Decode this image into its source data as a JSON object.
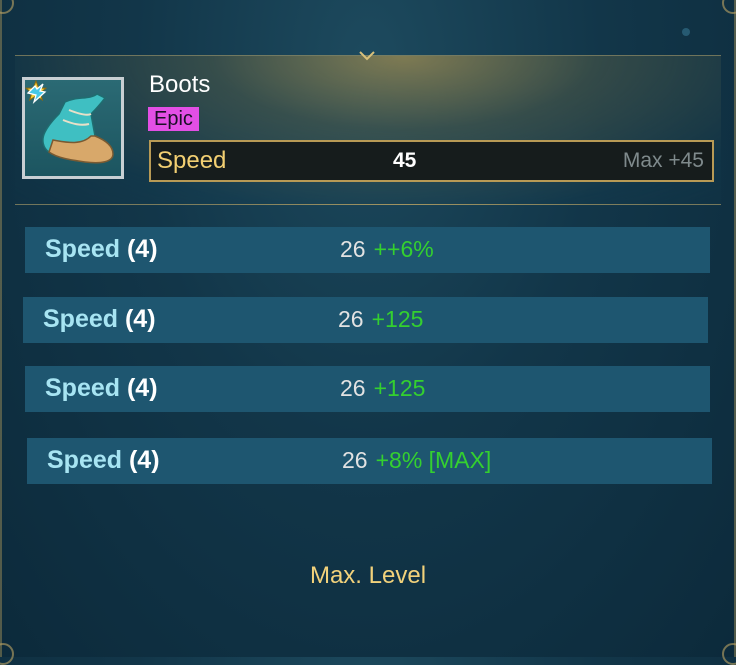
{
  "item": {
    "name": "Boots",
    "rarity": "Epic",
    "icon": "boots-icon",
    "rank_icon": "star-icon",
    "set_icon": "speed-set-icon"
  },
  "main_stat": {
    "name": "Speed",
    "value": "45",
    "max_label": "Max +45"
  },
  "substats": [
    {
      "name": "Speed",
      "rolls": "(4)",
      "value": "26",
      "bonus": "++6%"
    },
    {
      "name": "Speed",
      "rolls": "(4)",
      "value": "26",
      "bonus": "+125"
    },
    {
      "name": "Speed",
      "rolls": "(4)",
      "value": "26",
      "bonus": "+125"
    },
    {
      "name": "Speed",
      "rolls": "(4)",
      "value": "26",
      "bonus": "+8% [MAX]"
    }
  ],
  "footer": {
    "status": "Max. Level"
  },
  "colors": {
    "rarity_epic": "#e34fe5",
    "main_stat_name": "#f2cf72",
    "substat_name": "#a7e4f2",
    "bonus": "#34d02f",
    "status": "#f2d27b"
  }
}
